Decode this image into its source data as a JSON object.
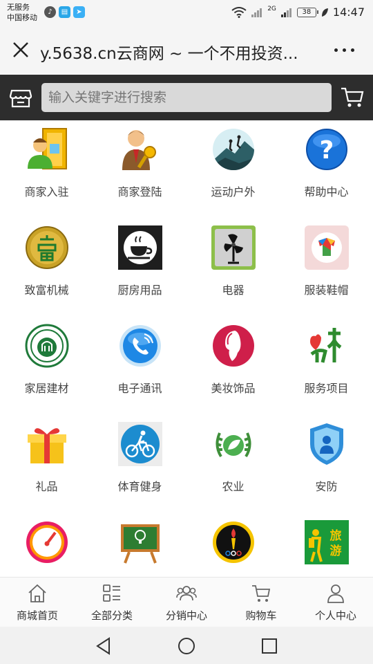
{
  "status": {
    "carrier_line1": "无服务",
    "carrier_line2": "中国移动",
    "network_type": "2G",
    "battery": "38",
    "time": "14:47"
  },
  "browser": {
    "title": "y.5638.cn云商网 ~ 一个不用投资..."
  },
  "search": {
    "placeholder": "输入关键字进行搜索"
  },
  "categories": [
    {
      "label": "商家入驻",
      "icon": "merchant-join-icon"
    },
    {
      "label": "商家登陆",
      "icon": "merchant-login-icon"
    },
    {
      "label": "运动户外",
      "icon": "outdoor-sports-icon"
    },
    {
      "label": "帮助中心",
      "icon": "help-icon"
    },
    {
      "label": "致富机械",
      "icon": "machinery-icon"
    },
    {
      "label": "厨房用品",
      "icon": "kitchen-icon"
    },
    {
      "label": "电器",
      "icon": "appliance-fan-icon"
    },
    {
      "label": "服装鞋帽",
      "icon": "clothing-icon"
    },
    {
      "label": "家居建材",
      "icon": "home-building-icon"
    },
    {
      "label": "电子通讯",
      "icon": "telecom-phone-icon"
    },
    {
      "label": "美妆饰品",
      "icon": "beauty-icon"
    },
    {
      "label": "服务项目",
      "icon": "service-village-icon"
    },
    {
      "label": "礼品",
      "icon": "gift-icon"
    },
    {
      "label": "体育健身",
      "icon": "cycling-icon"
    },
    {
      "label": "农业",
      "icon": "agriculture-icon"
    },
    {
      "label": "安防",
      "icon": "security-shield-icon"
    },
    {
      "label": "",
      "icon": "speedometer-icon"
    },
    {
      "label": "",
      "icon": "education-board-icon"
    },
    {
      "label": "",
      "icon": "torch-badge-icon"
    },
    {
      "label": "",
      "icon": "travel-icon"
    }
  ],
  "travel_badge": "旅游",
  "tabbar": [
    {
      "label": "商城首页",
      "icon": "home-icon"
    },
    {
      "label": "全部分类",
      "icon": "category-list-icon"
    },
    {
      "label": "分销中心",
      "icon": "distribution-users-icon"
    },
    {
      "label": "购物车",
      "icon": "shopping-cart-icon"
    },
    {
      "label": "个人中心",
      "icon": "user-icon"
    }
  ],
  "colors": {
    "header_bg": "#2d2d2d",
    "search_bg": "#d9d9d9",
    "browser_bg": "#f5f5f5",
    "tab_text": "#333333"
  }
}
